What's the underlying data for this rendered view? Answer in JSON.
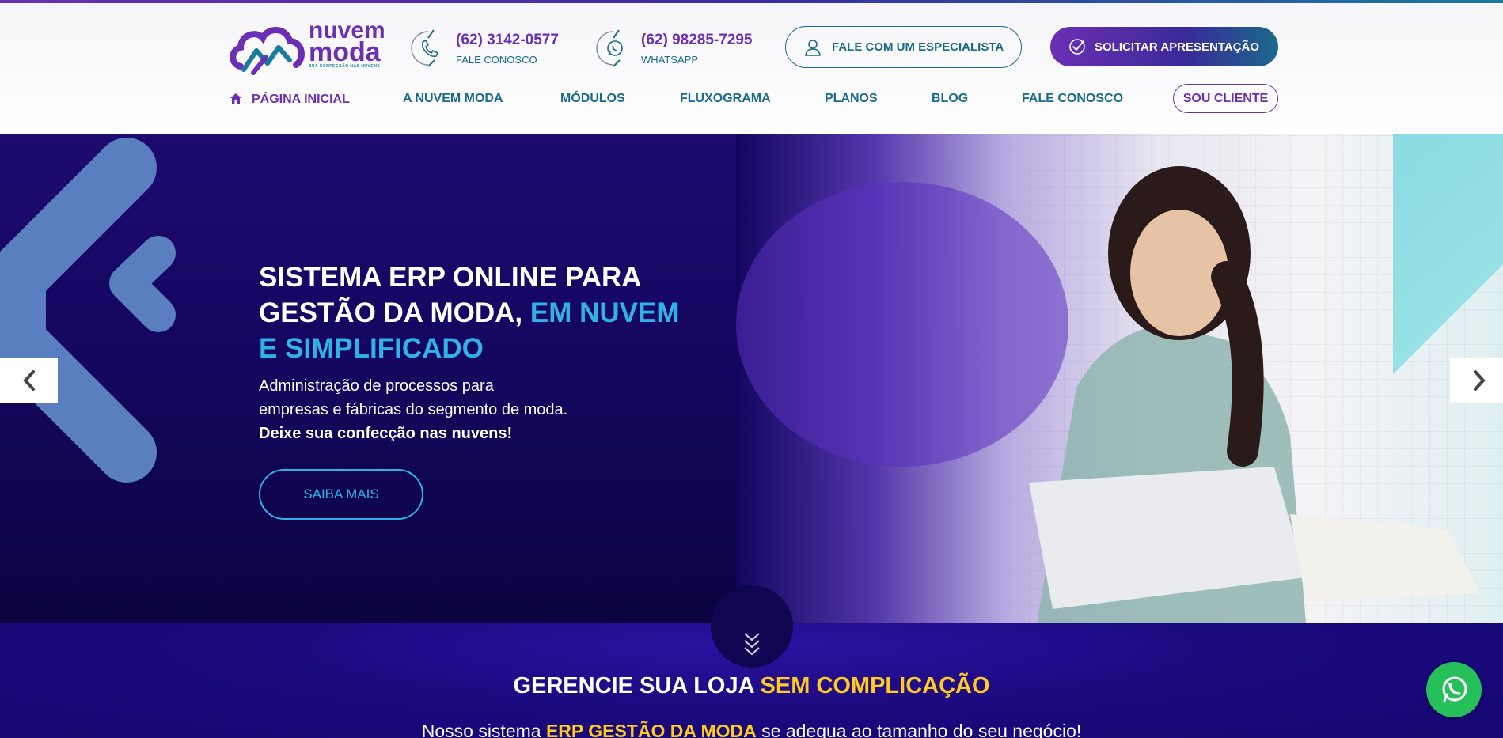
{
  "brand": {
    "logo_line1": "nuvem",
    "logo_line2": "moda",
    "tagline": "SUA CONFECÇÃO NAS NUVENS",
    "purple": "#6b2fb3",
    "teal": "#1a6a8a",
    "accent_blue": "#2fb2e6",
    "yellow": "#ffcb1f"
  },
  "header": {
    "phone": {
      "number": "(62) 3142-0577",
      "label": "FALE CONOSCO",
      "icon": "phone-icon"
    },
    "whatsapp": {
      "number": "(62) 98285-7295",
      "label": "WHATSAPP",
      "icon": "whatsapp-icon"
    },
    "specialist_button": "FALE COM UM ESPECIALISTA",
    "demo_button": "SOLICITAR APRESENTAÇÃO"
  },
  "nav": {
    "items": [
      {
        "label": "PÁGINA INICIAL",
        "active": true
      },
      {
        "label": "A NUVEM MODA"
      },
      {
        "label": "MÓDULOS"
      },
      {
        "label": "FLUXOGRAMA"
      },
      {
        "label": "PLANOS"
      },
      {
        "label": "BLOG"
      },
      {
        "label": "FALE CONOSCO"
      }
    ],
    "client_button": "SOU CLIENTE"
  },
  "hero": {
    "title_line1": "SISTEMA ERP ONLINE PARA",
    "title_line2_white": "GESTÃO DA MODA,",
    "title_line2_accent": "EM NUVEM",
    "title_line3_accent": "E SIMPLIFICADO",
    "desc_line1": "Administração de processos para",
    "desc_line2": "empresas e fábricas do segmento de moda.",
    "desc_strong": "Deixe sua confecção nas nuvens!",
    "cta": "SAIBA MAIS"
  },
  "section2": {
    "title_white": "GERENCIE SUA LOJA",
    "title_yellow": "SEM COMPLICAÇÃO",
    "sub_before": "Nosso sistema",
    "sub_highlight": "ERP GESTÃO DA MODA",
    "sub_after": "se adequa ao tamanho do seu negócio!"
  }
}
